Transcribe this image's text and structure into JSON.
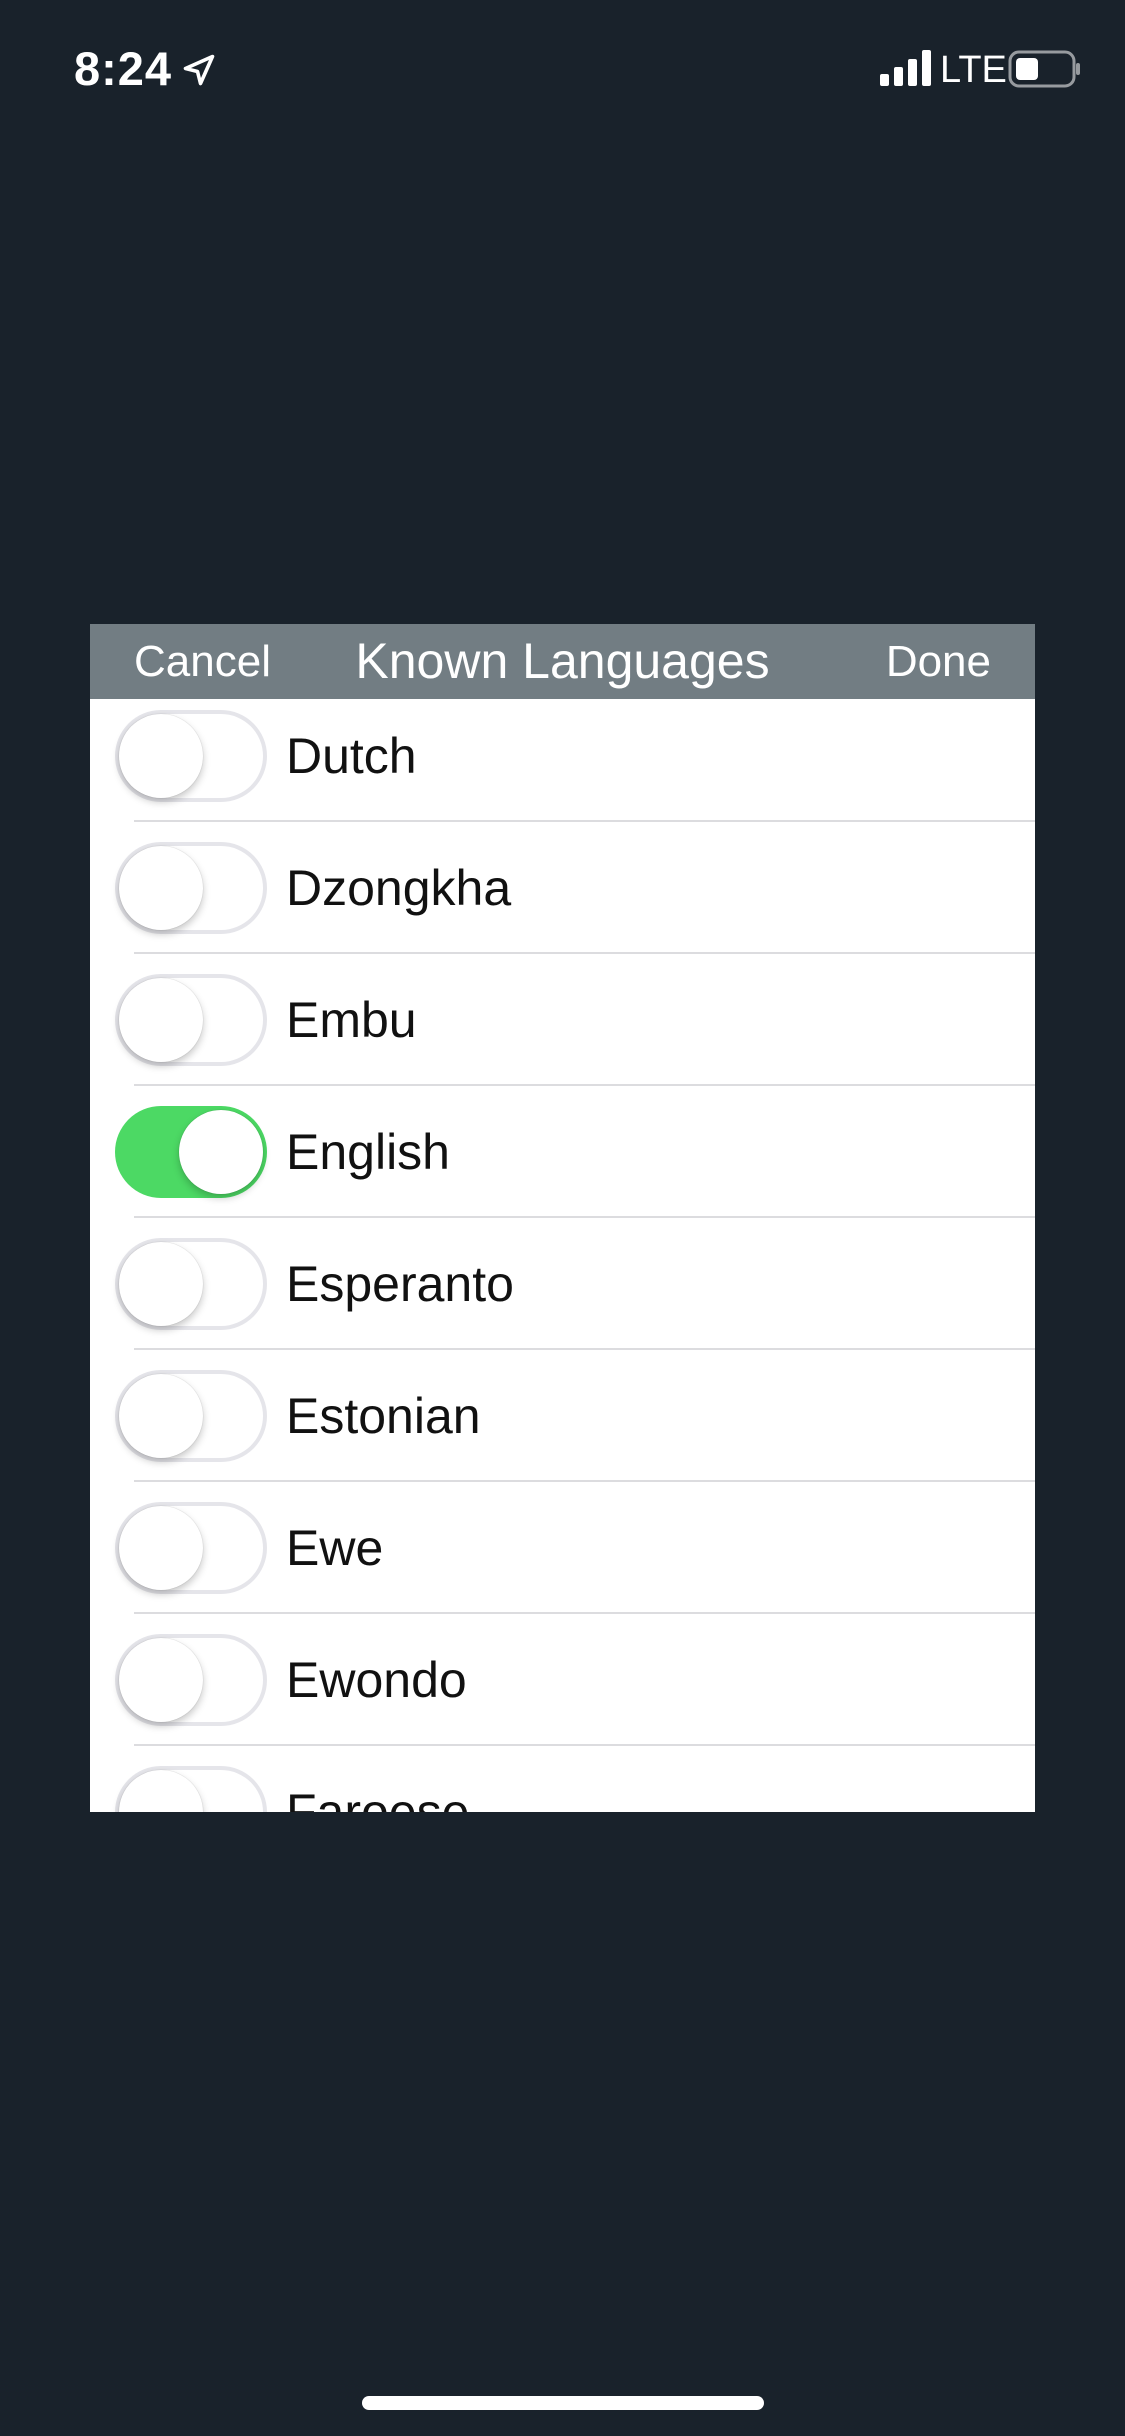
{
  "status_bar": {
    "time": "8:24",
    "network": "LTE",
    "icons": {
      "location": "location-arrow-icon",
      "signal": "cellular-signal-icon",
      "battery": "battery-icon"
    }
  },
  "modal": {
    "cancel_label": "Cancel",
    "title": "Known Languages",
    "done_label": "Done",
    "languages": [
      {
        "label": "Dutch",
        "enabled": false
      },
      {
        "label": "Dzongkha",
        "enabled": false
      },
      {
        "label": "Embu",
        "enabled": false
      },
      {
        "label": "English",
        "enabled": true
      },
      {
        "label": "Esperanto",
        "enabled": false
      },
      {
        "label": "Estonian",
        "enabled": false
      },
      {
        "label": "Ewe",
        "enabled": false
      },
      {
        "label": "Ewondo",
        "enabled": false
      },
      {
        "label": "Faroese",
        "enabled": false
      }
    ]
  },
  "colors": {
    "background": "#19222b",
    "header": "#727d83",
    "toggle_on": "#4cd964",
    "toggle_off_border": "#e5e5ea"
  }
}
